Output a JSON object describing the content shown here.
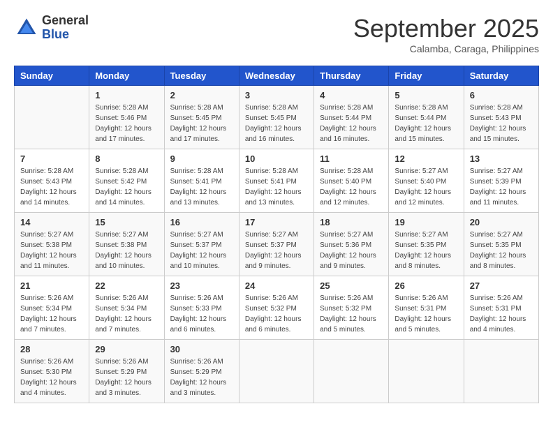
{
  "header": {
    "logo_general": "General",
    "logo_blue": "Blue",
    "month": "September 2025",
    "location": "Calamba, Caraga, Philippines"
  },
  "days_of_week": [
    "Sunday",
    "Monday",
    "Tuesday",
    "Wednesday",
    "Thursday",
    "Friday",
    "Saturday"
  ],
  "weeks": [
    [
      {
        "day": "",
        "sunrise": "",
        "sunset": "",
        "daylight": ""
      },
      {
        "day": "1",
        "sunrise": "Sunrise: 5:28 AM",
        "sunset": "Sunset: 5:46 PM",
        "daylight": "Daylight: 12 hours and 17 minutes."
      },
      {
        "day": "2",
        "sunrise": "Sunrise: 5:28 AM",
        "sunset": "Sunset: 5:45 PM",
        "daylight": "Daylight: 12 hours and 17 minutes."
      },
      {
        "day": "3",
        "sunrise": "Sunrise: 5:28 AM",
        "sunset": "Sunset: 5:45 PM",
        "daylight": "Daylight: 12 hours and 16 minutes."
      },
      {
        "day": "4",
        "sunrise": "Sunrise: 5:28 AM",
        "sunset": "Sunset: 5:44 PM",
        "daylight": "Daylight: 12 hours and 16 minutes."
      },
      {
        "day": "5",
        "sunrise": "Sunrise: 5:28 AM",
        "sunset": "Sunset: 5:44 PM",
        "daylight": "Daylight: 12 hours and 15 minutes."
      },
      {
        "day": "6",
        "sunrise": "Sunrise: 5:28 AM",
        "sunset": "Sunset: 5:43 PM",
        "daylight": "Daylight: 12 hours and 15 minutes."
      }
    ],
    [
      {
        "day": "7",
        "sunrise": "Sunrise: 5:28 AM",
        "sunset": "Sunset: 5:43 PM",
        "daylight": "Daylight: 12 hours and 14 minutes."
      },
      {
        "day": "8",
        "sunrise": "Sunrise: 5:28 AM",
        "sunset": "Sunset: 5:42 PM",
        "daylight": "Daylight: 12 hours and 14 minutes."
      },
      {
        "day": "9",
        "sunrise": "Sunrise: 5:28 AM",
        "sunset": "Sunset: 5:41 PM",
        "daylight": "Daylight: 12 hours and 13 minutes."
      },
      {
        "day": "10",
        "sunrise": "Sunrise: 5:28 AM",
        "sunset": "Sunset: 5:41 PM",
        "daylight": "Daylight: 12 hours and 13 minutes."
      },
      {
        "day": "11",
        "sunrise": "Sunrise: 5:28 AM",
        "sunset": "Sunset: 5:40 PM",
        "daylight": "Daylight: 12 hours and 12 minutes."
      },
      {
        "day": "12",
        "sunrise": "Sunrise: 5:27 AM",
        "sunset": "Sunset: 5:40 PM",
        "daylight": "Daylight: 12 hours and 12 minutes."
      },
      {
        "day": "13",
        "sunrise": "Sunrise: 5:27 AM",
        "sunset": "Sunset: 5:39 PM",
        "daylight": "Daylight: 12 hours and 11 minutes."
      }
    ],
    [
      {
        "day": "14",
        "sunrise": "Sunrise: 5:27 AM",
        "sunset": "Sunset: 5:38 PM",
        "daylight": "Daylight: 12 hours and 11 minutes."
      },
      {
        "day": "15",
        "sunrise": "Sunrise: 5:27 AM",
        "sunset": "Sunset: 5:38 PM",
        "daylight": "Daylight: 12 hours and 10 minutes."
      },
      {
        "day": "16",
        "sunrise": "Sunrise: 5:27 AM",
        "sunset": "Sunset: 5:37 PM",
        "daylight": "Daylight: 12 hours and 10 minutes."
      },
      {
        "day": "17",
        "sunrise": "Sunrise: 5:27 AM",
        "sunset": "Sunset: 5:37 PM",
        "daylight": "Daylight: 12 hours and 9 minutes."
      },
      {
        "day": "18",
        "sunrise": "Sunrise: 5:27 AM",
        "sunset": "Sunset: 5:36 PM",
        "daylight": "Daylight: 12 hours and 9 minutes."
      },
      {
        "day": "19",
        "sunrise": "Sunrise: 5:27 AM",
        "sunset": "Sunset: 5:35 PM",
        "daylight": "Daylight: 12 hours and 8 minutes."
      },
      {
        "day": "20",
        "sunrise": "Sunrise: 5:27 AM",
        "sunset": "Sunset: 5:35 PM",
        "daylight": "Daylight: 12 hours and 8 minutes."
      }
    ],
    [
      {
        "day": "21",
        "sunrise": "Sunrise: 5:26 AM",
        "sunset": "Sunset: 5:34 PM",
        "daylight": "Daylight: 12 hours and 7 minutes."
      },
      {
        "day": "22",
        "sunrise": "Sunrise: 5:26 AM",
        "sunset": "Sunset: 5:34 PM",
        "daylight": "Daylight: 12 hours and 7 minutes."
      },
      {
        "day": "23",
        "sunrise": "Sunrise: 5:26 AM",
        "sunset": "Sunset: 5:33 PM",
        "daylight": "Daylight: 12 hours and 6 minutes."
      },
      {
        "day": "24",
        "sunrise": "Sunrise: 5:26 AM",
        "sunset": "Sunset: 5:32 PM",
        "daylight": "Daylight: 12 hours and 6 minutes."
      },
      {
        "day": "25",
        "sunrise": "Sunrise: 5:26 AM",
        "sunset": "Sunset: 5:32 PM",
        "daylight": "Daylight: 12 hours and 5 minutes."
      },
      {
        "day": "26",
        "sunrise": "Sunrise: 5:26 AM",
        "sunset": "Sunset: 5:31 PM",
        "daylight": "Daylight: 12 hours and 5 minutes."
      },
      {
        "day": "27",
        "sunrise": "Sunrise: 5:26 AM",
        "sunset": "Sunset: 5:31 PM",
        "daylight": "Daylight: 12 hours and 4 minutes."
      }
    ],
    [
      {
        "day": "28",
        "sunrise": "Sunrise: 5:26 AM",
        "sunset": "Sunset: 5:30 PM",
        "daylight": "Daylight: 12 hours and 4 minutes."
      },
      {
        "day": "29",
        "sunrise": "Sunrise: 5:26 AM",
        "sunset": "Sunset: 5:29 PM",
        "daylight": "Daylight: 12 hours and 3 minutes."
      },
      {
        "day": "30",
        "sunrise": "Sunrise: 5:26 AM",
        "sunset": "Sunset: 5:29 PM",
        "daylight": "Daylight: 12 hours and 3 minutes."
      },
      {
        "day": "",
        "sunrise": "",
        "sunset": "",
        "daylight": ""
      },
      {
        "day": "",
        "sunrise": "",
        "sunset": "",
        "daylight": ""
      },
      {
        "day": "",
        "sunrise": "",
        "sunset": "",
        "daylight": ""
      },
      {
        "day": "",
        "sunrise": "",
        "sunset": "",
        "daylight": ""
      }
    ]
  ]
}
